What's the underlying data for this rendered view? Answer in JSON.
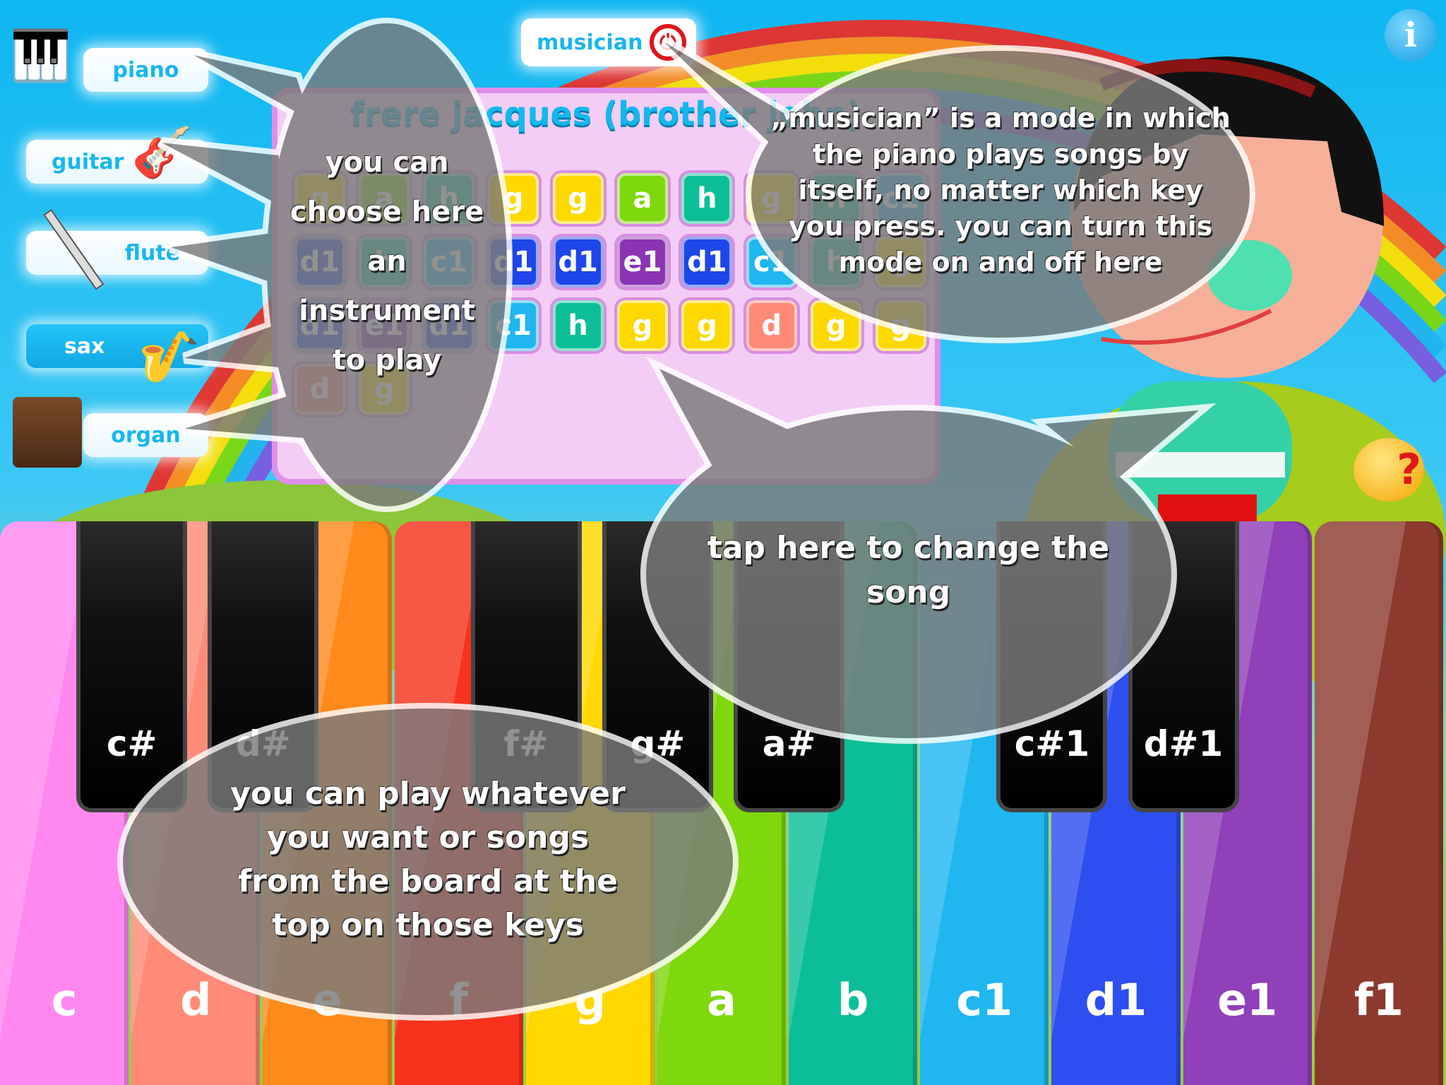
{
  "colors": {
    "sky": "#0fb6f2",
    "accent": "#19b6ee",
    "power": "#e0141c",
    "board": "#f3cdf5",
    "notes": {
      "c": "#ff88f0",
      "d": "#ff8a78",
      "e": "#ff8a1c",
      "f": "#f8321c",
      "g": "#ffd800",
      "a": "#7ed80c",
      "h": "#0cbe98",
      "b": "#0cbe98",
      "c1": "#20b6f0",
      "d1": "#1e46e8",
      "e1": "#8a34b4",
      "f1": "#8c3a2e"
    }
  },
  "instruments": [
    {
      "label": "piano",
      "icon": "grand-piano-icon",
      "selected": true
    },
    {
      "label": "guitar",
      "icon": "electric-guitar-icon"
    },
    {
      "label": "flute",
      "icon": "flute-icon"
    },
    {
      "label": "sax",
      "icon": "saxophone-icon"
    },
    {
      "label": "organ",
      "icon": "organ-icon"
    }
  ],
  "musician": {
    "label": "musician",
    "icon": "power-icon",
    "state": "on"
  },
  "info": {
    "icon": "info-icon",
    "glyph": "i"
  },
  "help": {
    "icon": "help-emoji-icon",
    "glyph": "?"
  },
  "song": {
    "title": "frere jacques (brother john)",
    "rows": [
      [
        "g",
        "a",
        "h",
        "g",
        "g",
        "a",
        "h",
        "g",
        "h",
        "c1"
      ],
      [
        "d1",
        "h",
        "c1",
        "d1",
        "d1",
        "e1",
        "d1",
        "c1",
        "h",
        "g"
      ],
      [
        "d1",
        "e1",
        "d1",
        "c1",
        "h",
        "g",
        "g",
        "d",
        "g",
        "g"
      ],
      [
        "d",
        "g"
      ]
    ]
  },
  "keyboard": {
    "white": [
      {
        "label": "c",
        "color": "#ff88f0"
      },
      {
        "label": "d",
        "color": "#ff8a78"
      },
      {
        "label": "e",
        "color": "#ff8a1c"
      },
      {
        "label": "f",
        "color": "#f8321c"
      },
      {
        "label": "g",
        "color": "#ffd800"
      },
      {
        "label": "a",
        "color": "#7ed80c"
      },
      {
        "label": "b",
        "color": "#0cbe98"
      },
      {
        "label": "c1",
        "color": "#20b6f0"
      },
      {
        "label": "d1",
        "color": "#2e4ef0"
      },
      {
        "label": "e1",
        "color": "#9040b8"
      },
      {
        "label": "f1",
        "color": "#8c3a2e"
      }
    ],
    "black": [
      {
        "label": "c#",
        "after": 0
      },
      {
        "label": "d#",
        "after": 1
      },
      {
        "label": "f#",
        "after": 3
      },
      {
        "label": "g#",
        "after": 4
      },
      {
        "label": "a#",
        "after": 5
      },
      {
        "label": "c#1",
        "after": 7
      },
      {
        "label": "d#1",
        "after": 8
      }
    ]
  },
  "tips": {
    "instrument": [
      "you can",
      "choose here",
      "an",
      "instrument",
      "to play"
    ],
    "musician": [
      "„musician” is a mode in which",
      "the piano plays songs by",
      "itself, no matter which key",
      "you press. you can turn this",
      "mode on and off here"
    ],
    "song": [
      "tap here to change the",
      "song"
    ],
    "keys": [
      "you can play whatever",
      "you want or songs",
      "from the board at the",
      "top on those keys"
    ]
  }
}
